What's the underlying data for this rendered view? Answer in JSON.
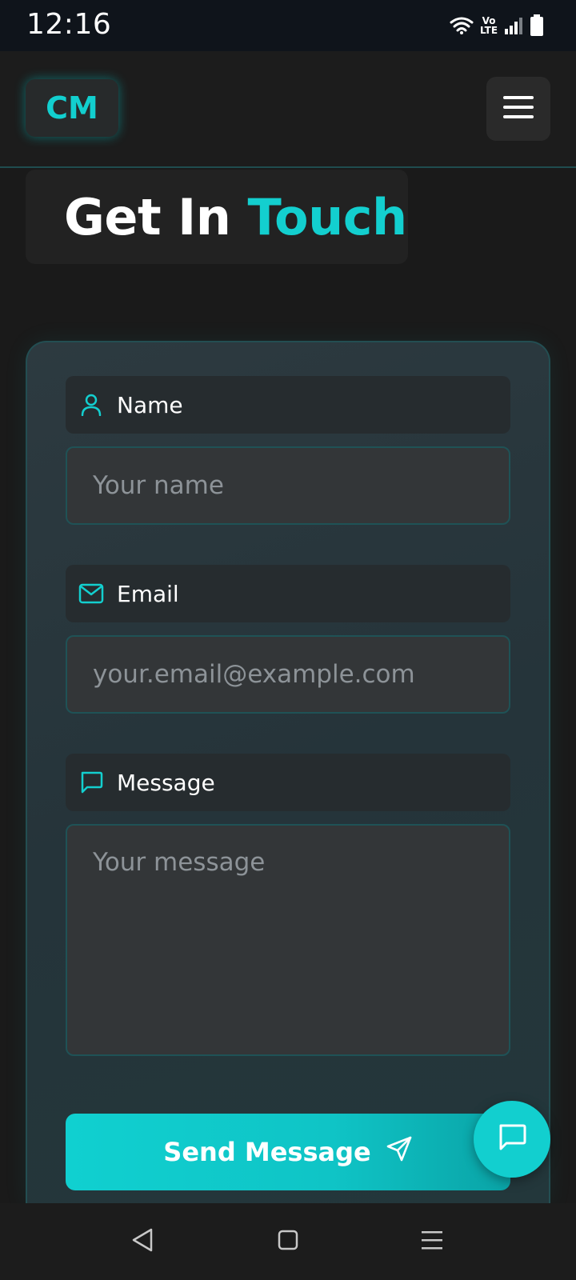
{
  "status_bar": {
    "time": "12:16",
    "volte_top": "Vo",
    "volte_bottom": "LTE"
  },
  "header": {
    "logo_text": "CM"
  },
  "title": {
    "prefix": "Get In",
    "accent": "Touch"
  },
  "form": {
    "name": {
      "label": "Name",
      "placeholder": "Your name",
      "value": ""
    },
    "email": {
      "label": "Email",
      "placeholder": "your.email@example.com",
      "value": ""
    },
    "message": {
      "label": "Message",
      "placeholder": "Your message",
      "value": ""
    },
    "submit_label": "Send Message"
  },
  "colors": {
    "accent": "#13cfcf",
    "background": "#1a1a1a",
    "card_border": "#234e52"
  },
  "icons": {
    "name": "user-icon",
    "email": "mail-icon",
    "message": "message-square-icon",
    "submit": "send-icon",
    "fab": "chat-icon",
    "menu": "hamburger-icon"
  }
}
